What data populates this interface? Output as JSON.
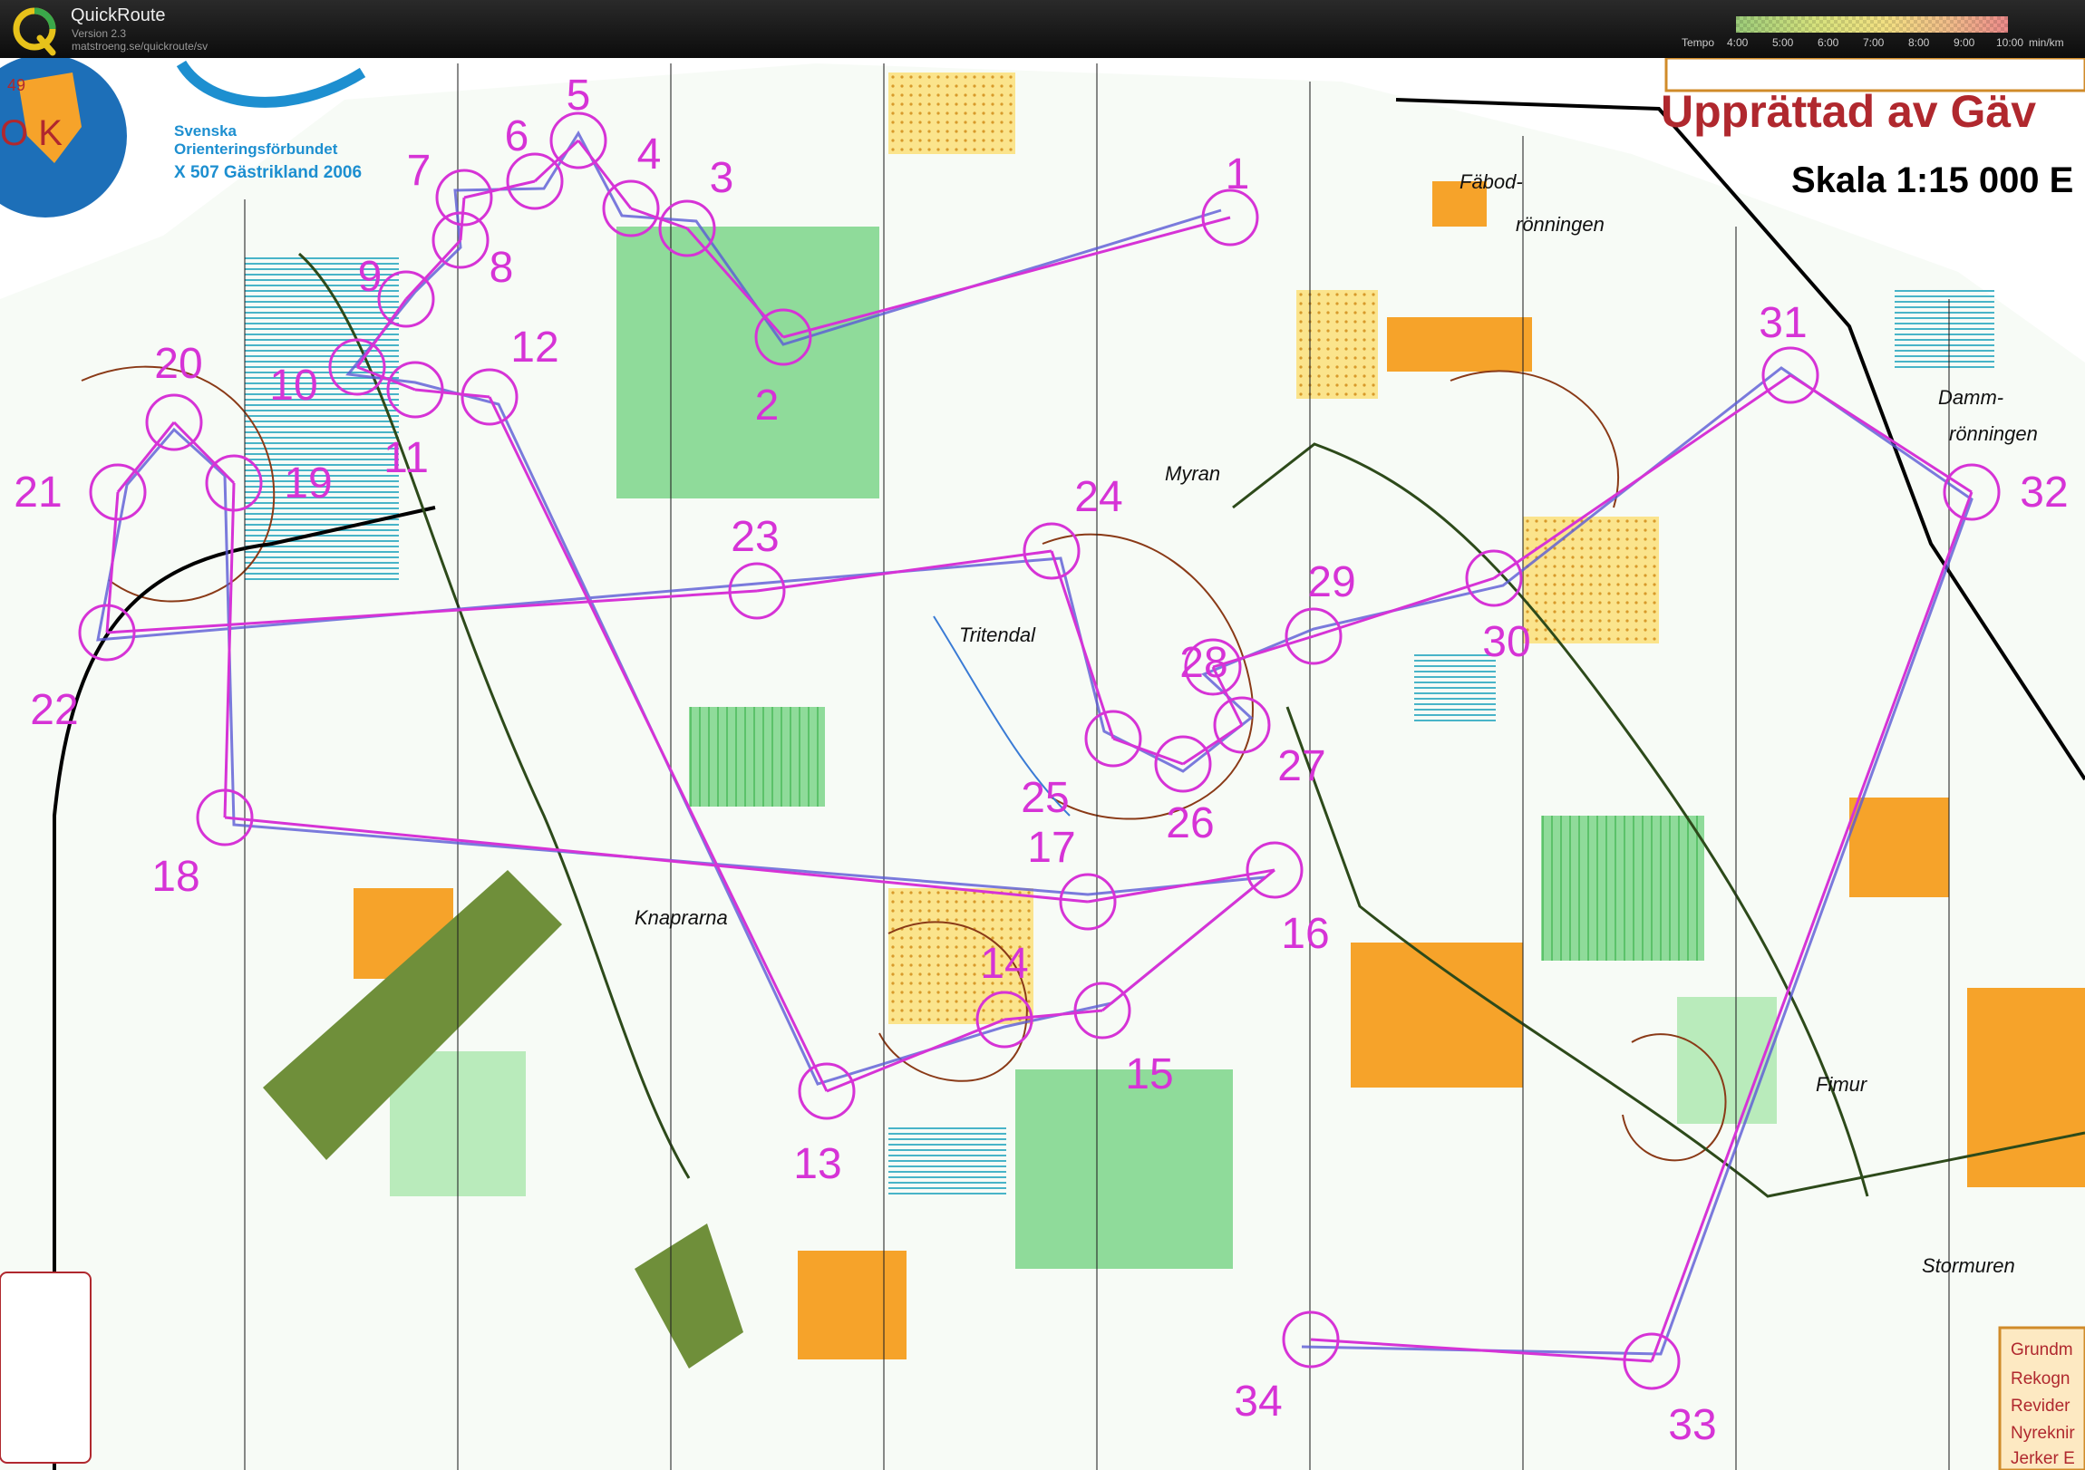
{
  "app": {
    "name": "QuickRoute",
    "version": "Version 2.3",
    "url": "matstroeng.se/quickroute/sv"
  },
  "tempo": {
    "label": "Tempo",
    "ticks": [
      "4:00",
      "5:00",
      "6:00",
      "7:00",
      "8:00",
      "9:00",
      "10:00"
    ],
    "unit": "min/km",
    "colors": [
      "#9ccc7a",
      "#d7e27d",
      "#f2e082",
      "#f0b98a",
      "#ec8a8a"
    ]
  },
  "map": {
    "header": "Upprättad av Gäv",
    "scale": "Skala 1:15 000 E",
    "club_logo_number": "49",
    "club_logo_letters": "O K",
    "federation_line1": "Svenska",
    "federation_line2": "Orienteringsförbundet",
    "federation_line3": "X 507 Gästrikland 2006",
    "place_names": {
      "fabod1": "Fäbod-",
      "fabod2": "rönningen",
      "damm1": "Damm-",
      "damm2": "rönningen",
      "myran": "Myran",
      "tritendal": "Tritendal",
      "knaprarna": "Knaprarna",
      "fimur": "Fimur",
      "stormuren": "Stormuren"
    },
    "credits": [
      "Grundm",
      "Rekogn",
      "Revider",
      "Nyreknir",
      "Jerker E"
    ],
    "colors": {
      "course": "#d633d6",
      "route_blue": "#5a5ad6",
      "open_land": "#f6a32a",
      "forest_green": "#8fdb9a",
      "swamp": "#48b4c8",
      "contour": "#8a3a17"
    }
  },
  "controls": [
    {
      "label": "1"
    },
    {
      "label": "2"
    },
    {
      "label": "3"
    },
    {
      "label": "4"
    },
    {
      "label": "5"
    },
    {
      "label": "6"
    },
    {
      "label": "7"
    },
    {
      "label": "8"
    },
    {
      "label": "9"
    },
    {
      "label": "10"
    },
    {
      "label": "11"
    },
    {
      "label": "12"
    },
    {
      "label": "13"
    },
    {
      "label": "14"
    },
    {
      "label": "15"
    },
    {
      "label": "16"
    },
    {
      "label": "17"
    },
    {
      "label": "18"
    },
    {
      "label": "19"
    },
    {
      "label": "20"
    },
    {
      "label": "21"
    },
    {
      "label": "22"
    },
    {
      "label": "23"
    },
    {
      "label": "24"
    },
    {
      "label": "25"
    },
    {
      "label": "26"
    },
    {
      "label": "27"
    },
    {
      "label": "28"
    },
    {
      "label": "29"
    },
    {
      "label": "30"
    },
    {
      "label": "31"
    },
    {
      "label": "32"
    },
    {
      "label": "33"
    },
    {
      "label": "34"
    }
  ]
}
